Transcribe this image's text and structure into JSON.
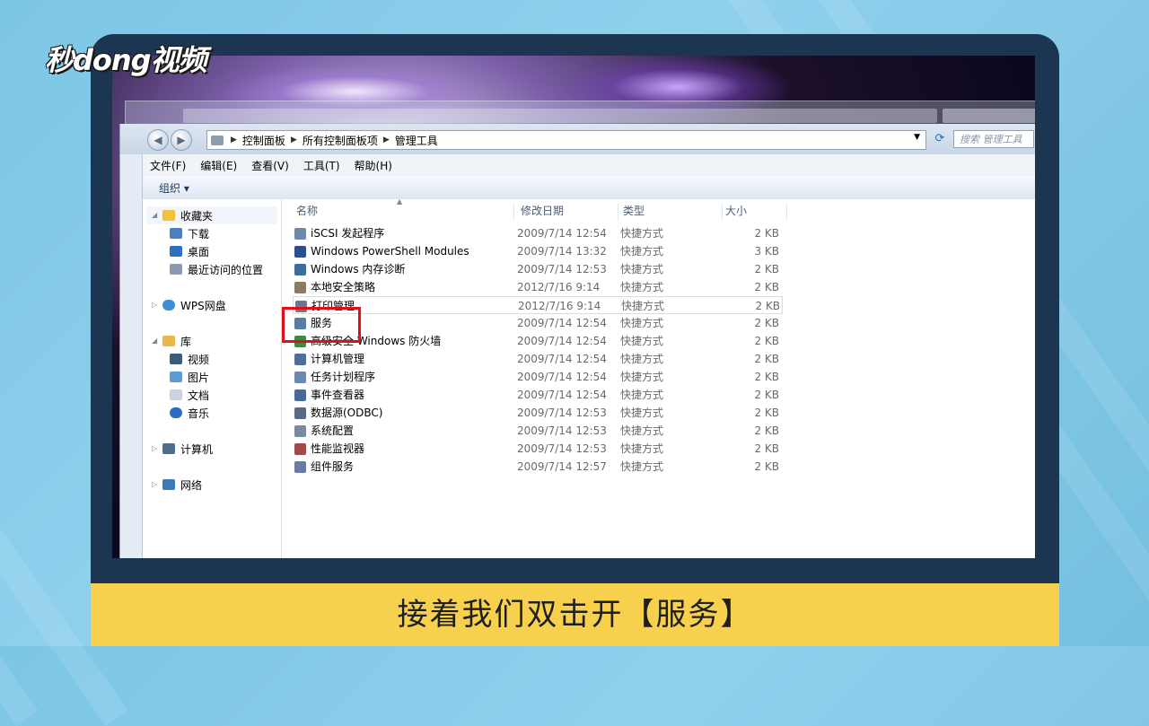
{
  "logo": {
    "text": "秒dong视频"
  },
  "caption": "接着我们双击开【服务】",
  "address_bar": {
    "crumbs": [
      "控制面板",
      "所有控制面板项",
      "管理工具"
    ],
    "search_placeholder": "搜索 管理工具"
  },
  "menu": [
    "文件(F)",
    "编辑(E)",
    "查看(V)",
    "工具(T)",
    "帮助(H)"
  ],
  "command_bar": {
    "organize": "组织 ▾"
  },
  "nav_pane": {
    "favorites": {
      "label": "收藏夹",
      "items": [
        "下载",
        "桌面",
        "最近访问的位置"
      ]
    },
    "wps": "WPS网盘",
    "library": {
      "label": "库",
      "items": [
        "视频",
        "图片",
        "文档",
        "音乐"
      ]
    },
    "computer": "计算机",
    "network": "网络"
  },
  "columns": {
    "name": "名称",
    "date": "修改日期",
    "type": "类型",
    "size": "大小"
  },
  "files": [
    {
      "name": "iSCSI 发起程序",
      "date": "2009/7/14 12:54",
      "type": "快捷方式",
      "size": "2 KB",
      "icon": "iscsi-icon"
    },
    {
      "name": "Windows PowerShell Modules",
      "date": "2009/7/14 13:32",
      "type": "快捷方式",
      "size": "3 KB",
      "icon": "powershell-icon"
    },
    {
      "name": "Windows 内存诊断",
      "date": "2009/7/14 12:53",
      "type": "快捷方式",
      "size": "2 KB",
      "icon": "memory-diagnostic-icon"
    },
    {
      "name": "本地安全策略",
      "date": "2012/7/16 9:14",
      "type": "快捷方式",
      "size": "2 KB",
      "icon": "security-policy-icon"
    },
    {
      "name": "打印管理",
      "date": "2012/7/16 9:14",
      "type": "快捷方式",
      "size": "2 KB",
      "icon": "printer-icon"
    },
    {
      "name": "服务",
      "date": "2009/7/14 12:54",
      "type": "快捷方式",
      "size": "2 KB",
      "icon": "services-icon"
    },
    {
      "name": "高级安全 Windows 防火墙",
      "date": "2009/7/14 12:54",
      "type": "快捷方式",
      "size": "2 KB",
      "icon": "firewall-icon"
    },
    {
      "name": "计算机管理",
      "date": "2009/7/14 12:54",
      "type": "快捷方式",
      "size": "2 KB",
      "icon": "computer-management-icon"
    },
    {
      "name": "任务计划程序",
      "date": "2009/7/14 12:54",
      "type": "快捷方式",
      "size": "2 KB",
      "icon": "task-scheduler-icon"
    },
    {
      "name": "事件查看器",
      "date": "2009/7/14 12:54",
      "type": "快捷方式",
      "size": "2 KB",
      "icon": "event-viewer-icon"
    },
    {
      "name": "数据源(ODBC)",
      "date": "2009/7/14 12:53",
      "type": "快捷方式",
      "size": "2 KB",
      "icon": "odbc-icon"
    },
    {
      "name": "系统配置",
      "date": "2009/7/14 12:53",
      "type": "快捷方式",
      "size": "2 KB",
      "icon": "system-config-icon"
    },
    {
      "name": "性能监视器",
      "date": "2009/7/14 12:53",
      "type": "快捷方式",
      "size": "2 KB",
      "icon": "performance-monitor-icon"
    },
    {
      "name": "组件服务",
      "date": "2009/7/14 12:57",
      "type": "快捷方式",
      "size": "2 KB",
      "icon": "component-services-icon"
    }
  ],
  "colors": {
    "caption_bar": "#f7d14d",
    "frame": "#1c3550",
    "highlight_box": "#e0101a"
  }
}
